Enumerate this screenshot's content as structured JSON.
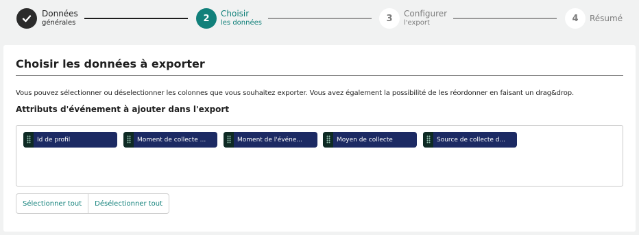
{
  "stepper": {
    "steps": [
      {
        "number": "",
        "title": "Données",
        "subtitle": "générales",
        "state": "done"
      },
      {
        "number": "2",
        "title": "Choisir",
        "subtitle": "les données",
        "state": "active"
      },
      {
        "number": "3",
        "title": "Configurer",
        "subtitle": "l'export",
        "state": "pending"
      },
      {
        "number": "4",
        "title": "Résumé",
        "subtitle": "",
        "state": "pending"
      }
    ]
  },
  "main": {
    "title": "Choisir les données à exporter",
    "description": "Vous pouvez sélectionner ou déselectionner les colonnes que vous souhaitez exporter. Vous avez également la possibilité de les réordonner en faisant un drag&drop.",
    "section_label": "Attributs d'événement à ajouter dans l'export",
    "attributes": [
      {
        "label": "Id de profil"
      },
      {
        "label": "Moment de collecte ..."
      },
      {
        "label": "Moment de l'événe..."
      },
      {
        "label": "Moyen de collecte"
      },
      {
        "label": "Source de collecte d..."
      }
    ],
    "select_all_label": "Sélectionner tout",
    "deselect_all_label": "Désélectionner tout"
  },
  "colors": {
    "accent": "#11807a",
    "chip_bg": "#1c2a63",
    "chip_handle": "#0e2a24",
    "done_step": "#2b2b2b"
  }
}
